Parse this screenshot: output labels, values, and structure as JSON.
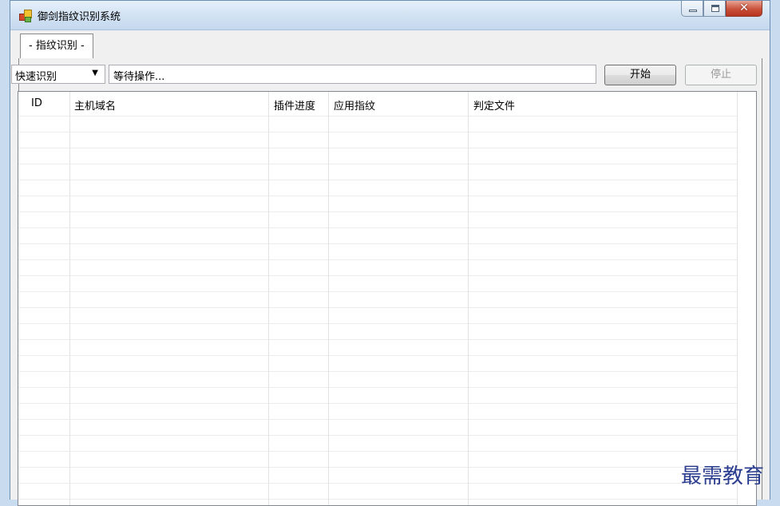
{
  "window": {
    "title": "御剑指纹识别系统"
  },
  "tabs": [
    {
      "label": "- 指纹识别 -"
    }
  ],
  "toolbar": {
    "mode_selected": "快速识别",
    "status_text": "等待操作...",
    "start_label": "开始",
    "stop_label": "停止"
  },
  "table": {
    "columns": [
      {
        "label": "ID"
      },
      {
        "label": "主机域名"
      },
      {
        "label": "插件进度"
      },
      {
        "label": "应用指纹"
      },
      {
        "label": "判定文件"
      }
    ],
    "rows": []
  },
  "watermark": {
    "text": "最需教育"
  },
  "icons": {
    "app": "app-icon",
    "minimize": "minimize-icon",
    "maximize": "maximize-icon",
    "close": "close-icon",
    "dropdown": "chevron-down-icon"
  },
  "colors": {
    "titlebar": "#cfe0f2",
    "close_button": "#c9503a",
    "window_bg": "#f0f0f0",
    "watermark": "#2a3d8f"
  }
}
